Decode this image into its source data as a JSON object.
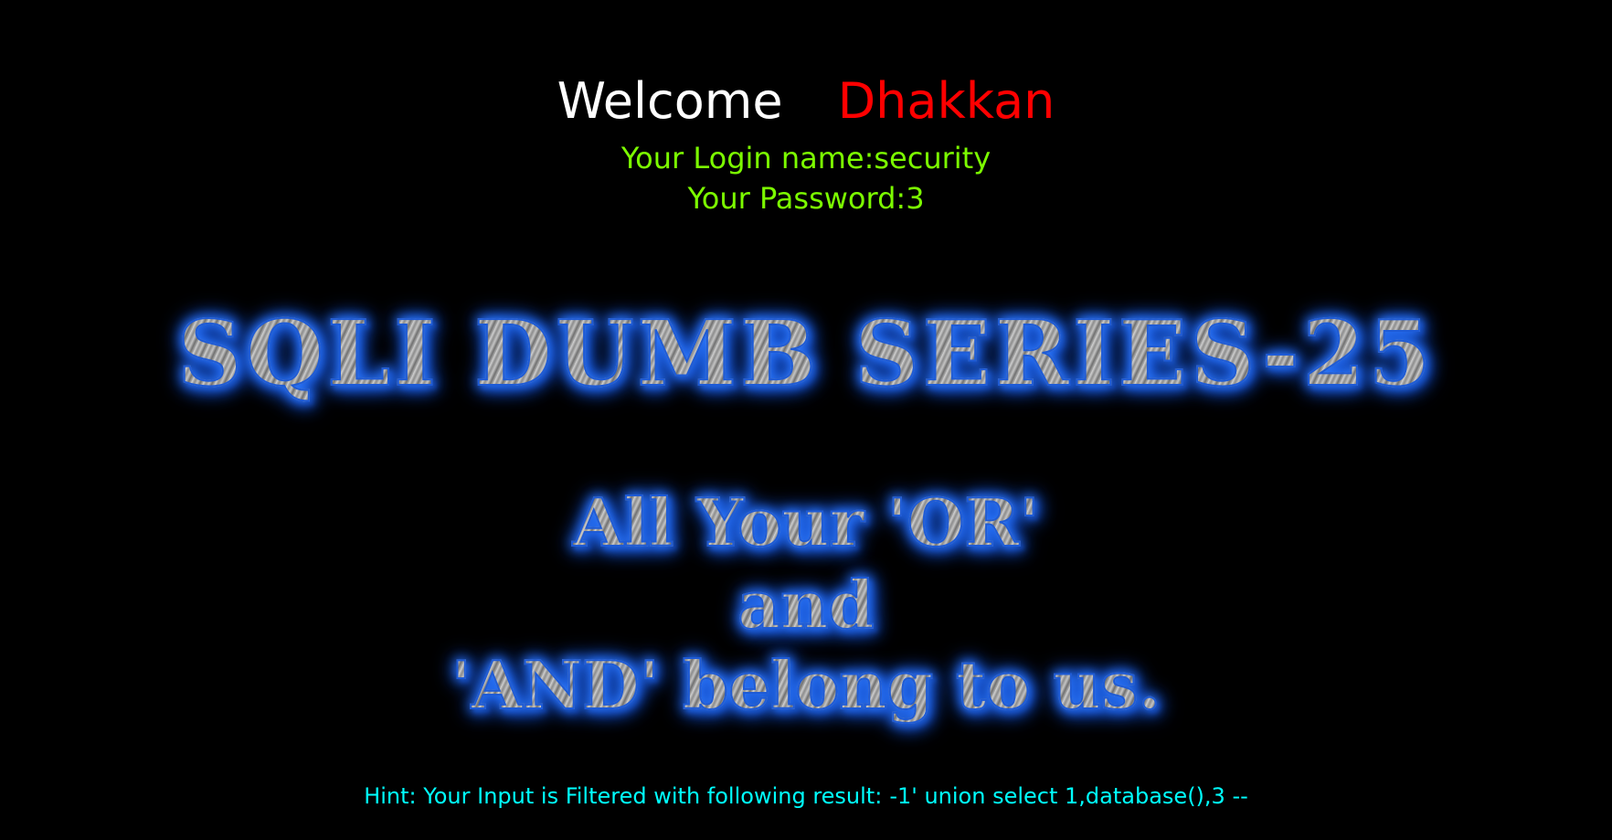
{
  "welcome": {
    "greeting": "Welcome",
    "name": "Dhakkan"
  },
  "login": {
    "name_line": "Your Login name:security",
    "password_line": "Your Password:3"
  },
  "banner": {
    "title": "SQLI DUMB SERIES-25",
    "slogan_line1": "All Your 'OR'",
    "slogan_line2": "and",
    "slogan_line3": "'AND' belong to us."
  },
  "hint": {
    "label": "Hint: Your Input is Filtered with following result:",
    "result": "-1' union select 1,database(),3 --"
  },
  "colors": {
    "background": "#000000",
    "greeting": "#ffffff",
    "name": "#ff0000",
    "login_text": "#7cfc00",
    "hint_text": "#00ffff",
    "banner_glow": "#2f7bff"
  }
}
